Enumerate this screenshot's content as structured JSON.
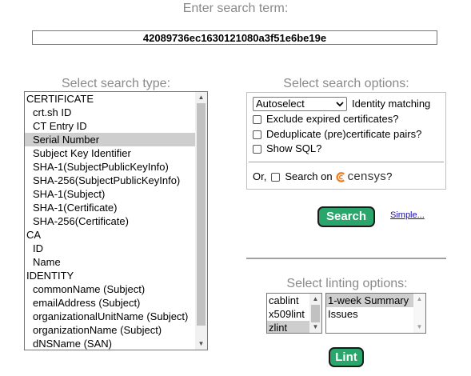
{
  "search": {
    "title": "Enter search term:",
    "value": "42089736ec1630121080a3f51e6be19e"
  },
  "search_type": {
    "title": "Select search type:",
    "options": [
      {
        "label": "CERTIFICATE",
        "group": true
      },
      {
        "label": "crt.sh ID"
      },
      {
        "label": "CT Entry ID"
      },
      {
        "label": "Serial Number",
        "selected": true
      },
      {
        "label": "Subject Key Identifier"
      },
      {
        "label": "SHA-1(SubjectPublicKeyInfo)"
      },
      {
        "label": "SHA-256(SubjectPublicKeyInfo)"
      },
      {
        "label": "SHA-1(Subject)"
      },
      {
        "label": "SHA-1(Certificate)"
      },
      {
        "label": "SHA-256(Certificate)"
      },
      {
        "label": "CA",
        "group": true
      },
      {
        "label": "ID"
      },
      {
        "label": "Name"
      },
      {
        "label": "IDENTITY",
        "group": true
      },
      {
        "label": "commonName (Subject)"
      },
      {
        "label": "emailAddress (Subject)"
      },
      {
        "label": "organizationalUnitName (Subject)"
      },
      {
        "label": "organizationName (Subject)"
      },
      {
        "label": "dNSName (SAN)"
      }
    ]
  },
  "options": {
    "title": "Select search options:",
    "matching_select_value": "Autoselect",
    "matching_label": "Identity matching",
    "exclude_expired_label": "Exclude expired certificates?",
    "deduplicate_label": "Deduplicate (pre)certificate pairs?",
    "show_sql_label": "Show SQL?",
    "or_label": "Or,",
    "search_on_label": "Search on",
    "censys_label": "censys",
    "censys_suffix": "?"
  },
  "buttons": {
    "search_label": "Search",
    "simple_label": "Simple...",
    "lint_label": "Lint"
  },
  "linting": {
    "title": "Select linting options:",
    "linters": [
      {
        "label": "cablint"
      },
      {
        "label": "x509lint"
      },
      {
        "label": "zlint",
        "selected": true
      }
    ],
    "modes": [
      {
        "label": "1-week Summary",
        "selected": true
      },
      {
        "label": "Issues"
      }
    ]
  },
  "colors": {
    "button_green": "#2aa66d",
    "title_grey": "#8a8a8a",
    "censys_orange": "#f48120"
  },
  "icons": [
    "chevron-down-icon",
    "arrow-up-icon",
    "arrow-down-icon",
    "censys-logo-icon"
  ]
}
